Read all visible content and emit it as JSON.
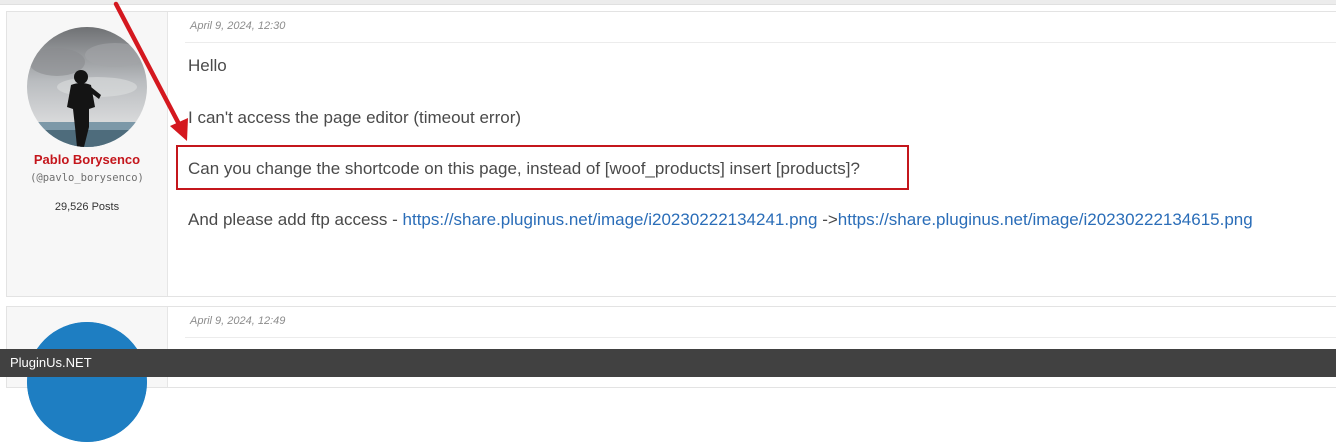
{
  "post1": {
    "date": "April 9, 2024, 12:30",
    "author": {
      "name": "Pablo Borysenco",
      "handle": "(@pavlo_borysenco)",
      "posts": "29,526 Posts"
    },
    "lines": {
      "greeting": "Hello",
      "line2": "I can't access the page editor (timeout error)",
      "line3": "Can you change the shortcode on this page, instead of [woof_products] insert [products]?",
      "line4_prefix": "And please add ftp access - ",
      "link1": "https://share.pluginus.net/image/i20230222134241.png",
      "separator": " ->",
      "link2": "https://share.pluginus.net/image/i20230222134615.png"
    }
  },
  "post2": {
    "date": "April 9, 2024, 12:49"
  },
  "footer": {
    "brand": "PluginUs.NET"
  },
  "colors": {
    "author_name": "#c4161c",
    "annotation": "#c4161c",
    "link": "#2a6db8",
    "footer_bg": "#414141"
  }
}
